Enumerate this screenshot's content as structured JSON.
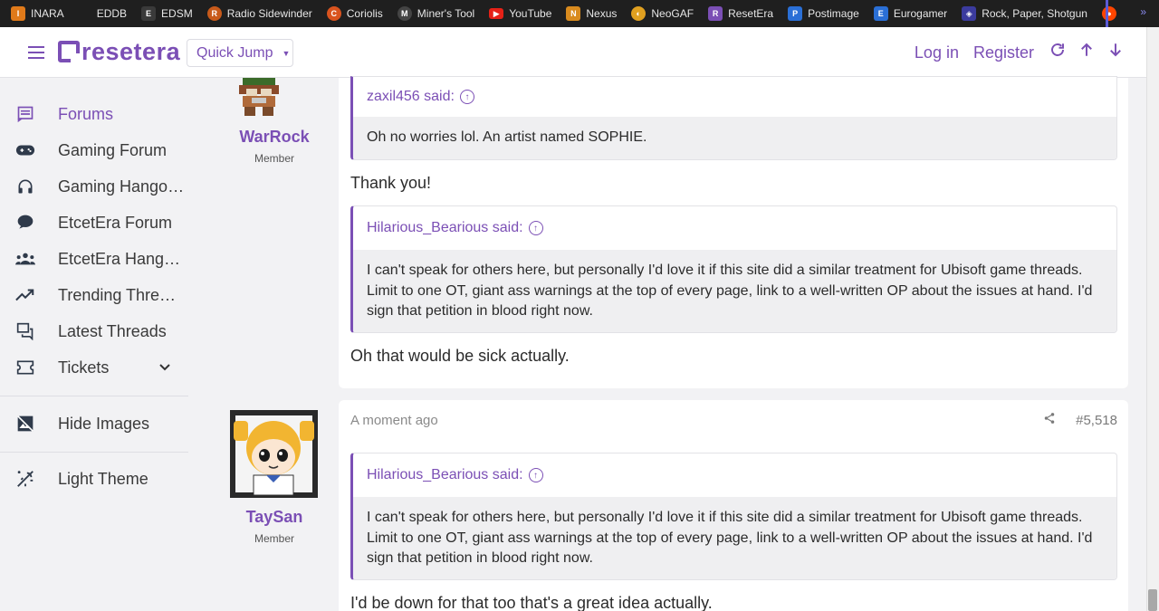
{
  "bookmarks": [
    {
      "label": "INARA",
      "color": "#e07a1a",
      "glyph": "I"
    },
    {
      "label": "EDDB",
      "color": "#1f1f1f",
      "glyph": ""
    },
    {
      "label": "EDSM",
      "color": "#3a3a3a",
      "glyph": "E"
    },
    {
      "label": "Radio Sidewinder",
      "color": "#c85a1a",
      "glyph": "R"
    },
    {
      "label": "Coriolis",
      "color": "#d9531e",
      "glyph": "C"
    },
    {
      "label": "Miner's Tool",
      "color": "#444444",
      "glyph": "M"
    },
    {
      "label": "YouTube",
      "color": "#e62117",
      "glyph": "▶"
    },
    {
      "label": "Nexus",
      "color": "#d98b1e",
      "glyph": "N"
    },
    {
      "label": "NeoGAF",
      "color": "#e0a020",
      "glyph": "◐"
    },
    {
      "label": "ResetEra",
      "color": "#7b4fb5",
      "glyph": "R"
    },
    {
      "label": "Postimage",
      "color": "#2a6fd6",
      "glyph": "P"
    },
    {
      "label": "Eurogamer",
      "color": "#2a6fd6",
      "glyph": "E"
    },
    {
      "label": "Rock, Paper, Shotgun",
      "color": "#3b3b9e",
      "glyph": "◈"
    },
    {
      "label": "",
      "color": "#ff4500",
      "glyph": "●"
    }
  ],
  "bookmarks_more": "»",
  "header": {
    "logo": "resetera",
    "quick_jump": "Quick Jump",
    "login": "Log in",
    "register": "Register"
  },
  "sidebar": {
    "items": [
      {
        "label": "Forums",
        "icon": "forum-icon"
      },
      {
        "label": "Gaming Forum",
        "icon": "gamepad-icon"
      },
      {
        "label": "Gaming Hango…",
        "icon": "headphones-icon"
      },
      {
        "label": "EtcetEra Forum",
        "icon": "chat-bubble-icon"
      },
      {
        "label": "EtcetEra Hang…",
        "icon": "group-icon"
      },
      {
        "label": "Trending Thre…",
        "icon": "trending-icon"
      },
      {
        "label": "Latest Threads",
        "icon": "threads-icon"
      },
      {
        "label": "Tickets",
        "icon": "ticket-icon"
      }
    ],
    "hide_images": "Hide Images",
    "light_theme": "Light Theme"
  },
  "posts": [
    {
      "user": "WarRock",
      "title": "Member",
      "quotes": [
        {
          "author": "zaxil456 said:",
          "text": "Oh no worries lol. An artist named SOPHIE."
        }
      ],
      "messages": [
        "Thank you!"
      ],
      "quote2": {
        "author": "Hilarious_Bearious said:",
        "text": "I can't speak for others here, but personally I'd love it if this site did a similar treatment for Ubisoft game threads. Limit to one OT, giant ass warnings at the top of every page, link to a well-written OP about the issues at hand. I'd sign that petition in blood right now."
      },
      "reply": "Oh that would be sick actually."
    },
    {
      "user": "TaySan",
      "title": "Member",
      "time": "A moment ago",
      "number": "#5,518",
      "quote": {
        "author": "Hilarious_Bearious said:",
        "text": "I can't speak for others here, but personally I'd love it if this site did a similar treatment for Ubisoft game threads. Limit to one OT, giant ass warnings at the top of every page, link to a well-written OP about the issues at hand. I'd sign that petition in blood right now."
      },
      "reply": "I'd be down for that too that's a great idea actually."
    }
  ],
  "colors": {
    "accent": "#7b4fb5",
    "bookmarks_bg": "#1f1f1f",
    "page_bg": "#f2f2f4"
  }
}
